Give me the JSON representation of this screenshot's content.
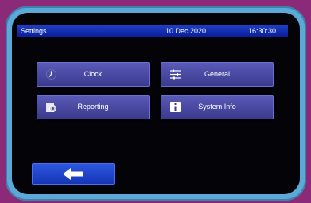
{
  "status_bar": {
    "title": "Settings",
    "date": "10 Dec 2020",
    "time": "16:30:30"
  },
  "menu": {
    "clock": {
      "label": "Clock",
      "icon": "clock-icon"
    },
    "general": {
      "label": "General",
      "icon": "sliders-icon"
    },
    "reporting": {
      "label": "Reporting",
      "icon": "report-gear-icon"
    },
    "system_info": {
      "label": "System Info",
      "icon": "info-icon"
    }
  },
  "back_button": {
    "icon": "arrow-left-icon"
  },
  "colors": {
    "background": "#8a2a78",
    "bezel": "#5aa9d6",
    "status_bar": "#0a1f9a",
    "menu_button": "#4a4aa8",
    "back_button": "#1e44cc"
  }
}
